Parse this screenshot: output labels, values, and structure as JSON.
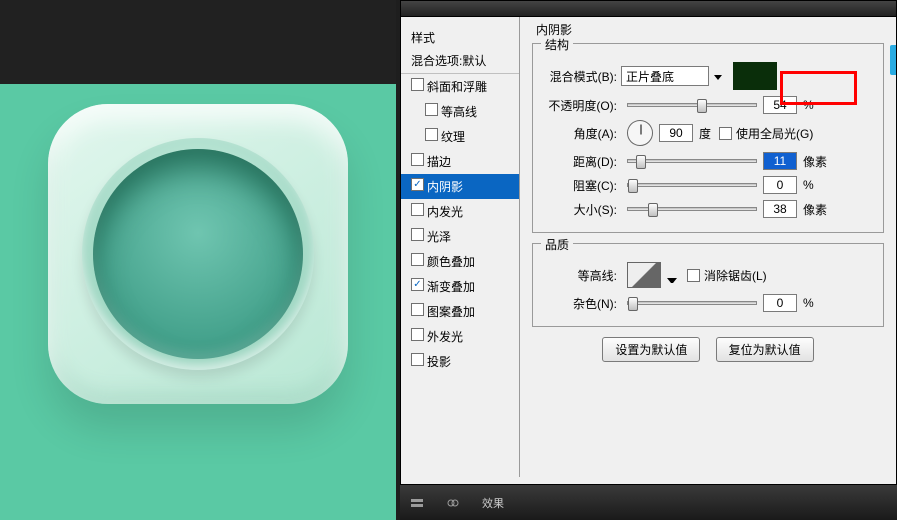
{
  "styles_panel": {
    "header": "样式",
    "blend_defaults": "混合选项:默认",
    "items": [
      {
        "label": "斜面和浮雕",
        "checked": false,
        "sub": false
      },
      {
        "label": "等高线",
        "checked": false,
        "sub": true
      },
      {
        "label": "纹理",
        "checked": false,
        "sub": true
      },
      {
        "label": "描边",
        "checked": false,
        "sub": false
      },
      {
        "label": "内阴影",
        "checked": true,
        "sub": false,
        "selected": true
      },
      {
        "label": "内发光",
        "checked": false,
        "sub": false
      },
      {
        "label": "光泽",
        "checked": false,
        "sub": false
      },
      {
        "label": "颜色叠加",
        "checked": false,
        "sub": false
      },
      {
        "label": "渐变叠加",
        "checked": true,
        "sub": false
      },
      {
        "label": "图案叠加",
        "checked": false,
        "sub": false
      },
      {
        "label": "外发光",
        "checked": false,
        "sub": false
      },
      {
        "label": "投影",
        "checked": false,
        "sub": false
      }
    ]
  },
  "main_title": "内阴影",
  "structure": {
    "title": "结构",
    "blend_mode_label": "混合模式(B):",
    "blend_mode_value": "正片叠底",
    "opacity_label": "不透明度(O):",
    "opacity_value": "54",
    "opacity_unit": "%",
    "angle_label": "角度(A):",
    "angle_value": "90",
    "angle_unit": "度",
    "global_light_label": "使用全局光(G)",
    "distance_label": "距离(D):",
    "distance_value": "11",
    "distance_unit": "像素",
    "choke_label": "阻塞(C):",
    "choke_value": "0",
    "choke_unit": "%",
    "size_label": "大小(S):",
    "size_value": "38",
    "size_unit": "像素"
  },
  "quality": {
    "title": "品质",
    "contour_label": "等高线:",
    "antialias_label": "消除锯齿(L)",
    "noise_label": "杂色(N):",
    "noise_value": "0",
    "noise_unit": "%"
  },
  "buttons": {
    "set_default": "设置为默认值",
    "reset_default": "复位为默认值"
  },
  "bottom": {
    "fx": "效果"
  }
}
